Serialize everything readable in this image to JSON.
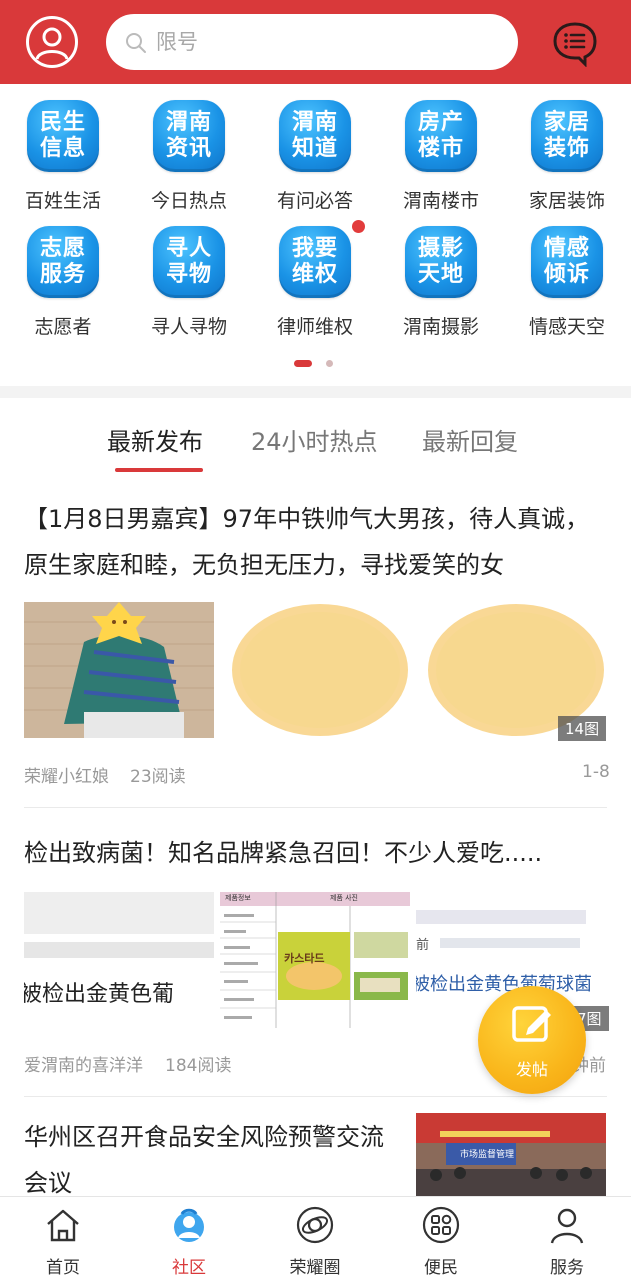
{
  "header": {
    "search_placeholder": "限号"
  },
  "grid": {
    "items": [
      {
        "tile": [
          "民生",
          "信息"
        ],
        "caption": "百姓生活"
      },
      {
        "tile": [
          "渭南",
          "资讯"
        ],
        "caption": "今日热点"
      },
      {
        "tile": [
          "渭南",
          "知道"
        ],
        "caption": "有问必答"
      },
      {
        "tile": [
          "房产",
          "楼市"
        ],
        "caption": "渭南楼市"
      },
      {
        "tile": [
          "家居",
          "装饰"
        ],
        "caption": "家居装饰"
      },
      {
        "tile": [
          "志愿",
          "服务"
        ],
        "caption": "志愿者"
      },
      {
        "tile": [
          "寻人",
          "寻物"
        ],
        "caption": "寻人寻物"
      },
      {
        "tile": [
          "我要",
          "维权"
        ],
        "caption": "律师维权"
      },
      {
        "tile": [
          "摄影",
          "天地"
        ],
        "caption": "渭南摄影"
      },
      {
        "tile": [
          "情感",
          "倾诉"
        ],
        "caption": "情感天空"
      }
    ]
  },
  "tabs": {
    "latest": "最新发布",
    "hot24": "24小时热点",
    "replies": "最新回复"
  },
  "posts": [
    {
      "title": "【1月8日男嘉宾】97年中铁帅气大男孩，待人真诚，原生家庭和睦，无负担无压力，寻找爱笑的女",
      "image_count": "14图",
      "author": "荣耀小红娘",
      "reads": "23阅读",
      "time": "1-8"
    },
    {
      "title": "检出致病菌！知名品牌紧急召回！不少人爱吃.....",
      "thumb_text": "被检出金黄色葡",
      "thumb_text_3": "被检出金黄色葡萄球菌",
      "thumb_prefix": "前",
      "product_table_header_1": "제품정보",
      "product_table_header_2": "제품 사진",
      "product_brand": "카스타드",
      "image_count": "7图",
      "author": "爱渭南的喜洋洋",
      "reads": "184阅读",
      "time": "钟前"
    },
    {
      "title": "华州区召开食品安全风险预警交流会议",
      "banner_text": "市场监督管理"
    }
  ],
  "fab": {
    "label": "发帖"
  },
  "bottom_nav": [
    {
      "label": "首页",
      "icon": "home-icon"
    },
    {
      "label": "社区",
      "icon": "community-icon"
    },
    {
      "label": "荣耀圈",
      "icon": "planet-icon"
    },
    {
      "label": "便民",
      "icon": "grid-apps-icon"
    },
    {
      "label": "服务",
      "icon": "user-icon"
    }
  ],
  "colors": {
    "brand_red": "#d9393a",
    "tile_blue": "#1a93e6",
    "fab_yellow": "#f9b51a"
  }
}
